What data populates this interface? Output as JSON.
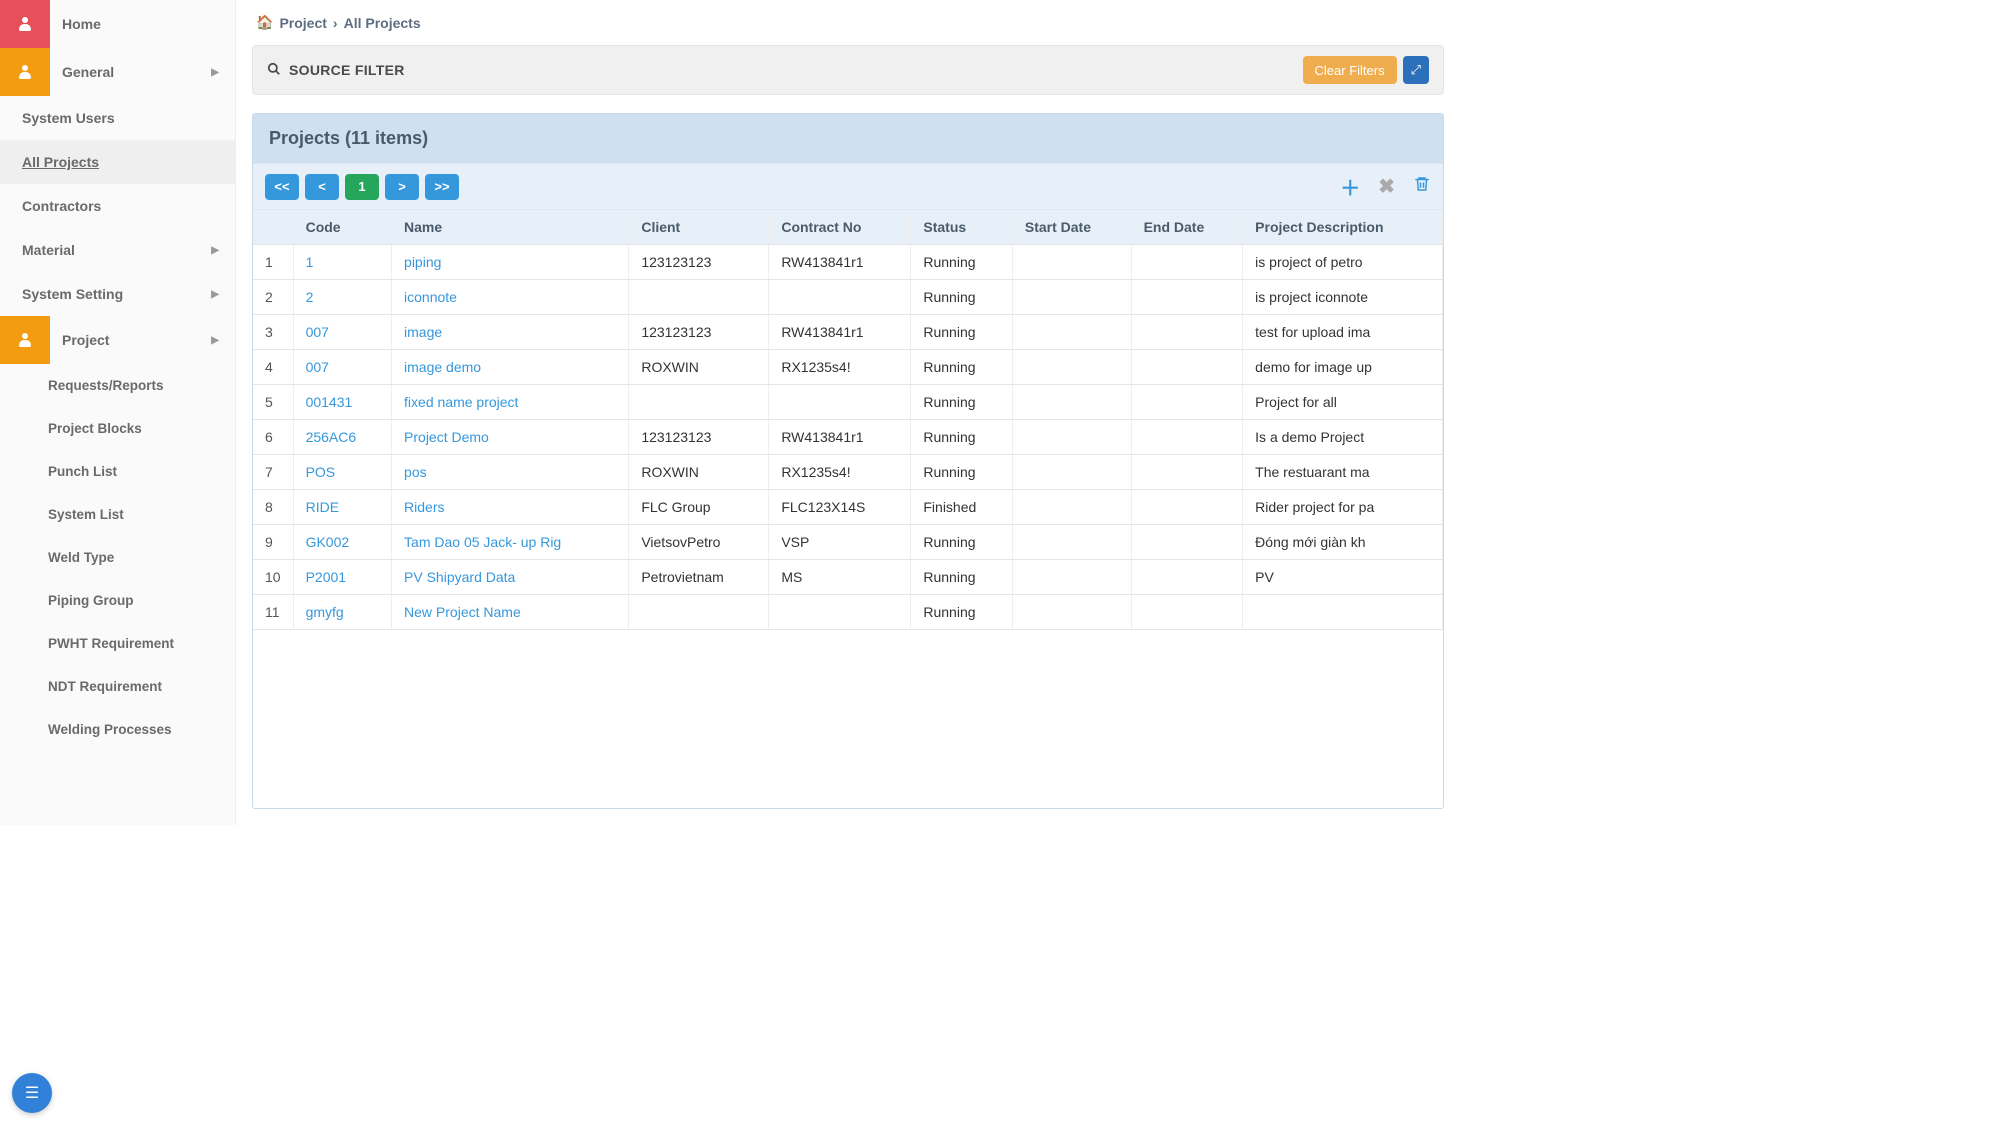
{
  "sidebar": {
    "home": "Home",
    "general": "General",
    "system_users": "System Users",
    "all_projects": "All Projects",
    "contractors": "Contractors",
    "material": "Material",
    "system_setting": "System Setting",
    "project": "Project",
    "sub": {
      "requests_reports": "Requests/Reports",
      "project_blocks": "Project Blocks",
      "punch_list": "Punch List",
      "system_list": "System List",
      "weld_type": "Weld Type",
      "piping_group": "Piping Group",
      "pwht": "PWHT Requirement",
      "ndt": "NDT Requirement",
      "welding_processes": "Welding Processes"
    }
  },
  "breadcrumb": {
    "parent": "Project",
    "current": "All Projects"
  },
  "filter": {
    "label": "SOURCE FILTER",
    "clear": "Clear Filters"
  },
  "panel": {
    "title": "Projects  (11 items)"
  },
  "pager": {
    "first": "<<",
    "prev": "<",
    "page": "1",
    "next": ">",
    "last": ">>"
  },
  "columns": [
    "Code",
    "Name",
    "Client",
    "Contract No",
    "Status",
    "Start Date",
    "End Date",
    "Project Description"
  ],
  "rows": [
    {
      "n": "1",
      "code": "1",
      "name": "piping",
      "client": "123123123",
      "contract": "RW413841r1",
      "status": "Running",
      "start": "",
      "end": "",
      "desc": "is project of petro"
    },
    {
      "n": "2",
      "code": "2",
      "name": "iconnote",
      "client": "",
      "contract": "",
      "status": "Running",
      "start": "",
      "end": "",
      "desc": "is project iconnote"
    },
    {
      "n": "3",
      "code": "007",
      "name": "image",
      "client": "123123123",
      "contract": "RW413841r1",
      "status": "Running",
      "start": "",
      "end": "",
      "desc": "test for upload ima"
    },
    {
      "n": "4",
      "code": "007",
      "name": "image demo",
      "client": "ROXWIN",
      "contract": "RX1235s4!",
      "status": "Running",
      "start": "",
      "end": "",
      "desc": "demo for image up"
    },
    {
      "n": "5",
      "code": "001431",
      "name": "fixed name project",
      "client": "",
      "contract": "",
      "status": "Running",
      "start": "",
      "end": "",
      "desc": "Project for all"
    },
    {
      "n": "6",
      "code": "256AC6",
      "name": "Project Demo",
      "client": "123123123",
      "contract": "RW413841r1",
      "status": "Running",
      "start": "",
      "end": "",
      "desc": "Is a demo Project"
    },
    {
      "n": "7",
      "code": "POS",
      "name": "pos",
      "client": "ROXWIN",
      "contract": "RX1235s4!",
      "status": "Running",
      "start": "",
      "end": "",
      "desc": "The restuarant ma"
    },
    {
      "n": "8",
      "code": "RIDE",
      "name": "Riders",
      "client": "FLC Group",
      "contract": "FLC123X14S",
      "status": "Finished",
      "start": "",
      "end": "",
      "desc": "Rider project for pa"
    },
    {
      "n": "9",
      "code": "GK002",
      "name": "Tam Dao 05 Jack- up Rig",
      "client": "VietsovPetro",
      "contract": "VSP",
      "status": "Running",
      "start": "",
      "end": "",
      "desc": "Đóng mới giàn kh"
    },
    {
      "n": "10",
      "code": "P2001",
      "name": "PV Shipyard Data",
      "client": "Petrovietnam",
      "contract": "MS",
      "status": "Running",
      "start": "",
      "end": "",
      "desc": "PV"
    },
    {
      "n": "11",
      "code": "gmyfg",
      "name": "New Project Name",
      "client": "",
      "contract": "",
      "status": "Running",
      "start": "",
      "end": "",
      "desc": ""
    }
  ]
}
